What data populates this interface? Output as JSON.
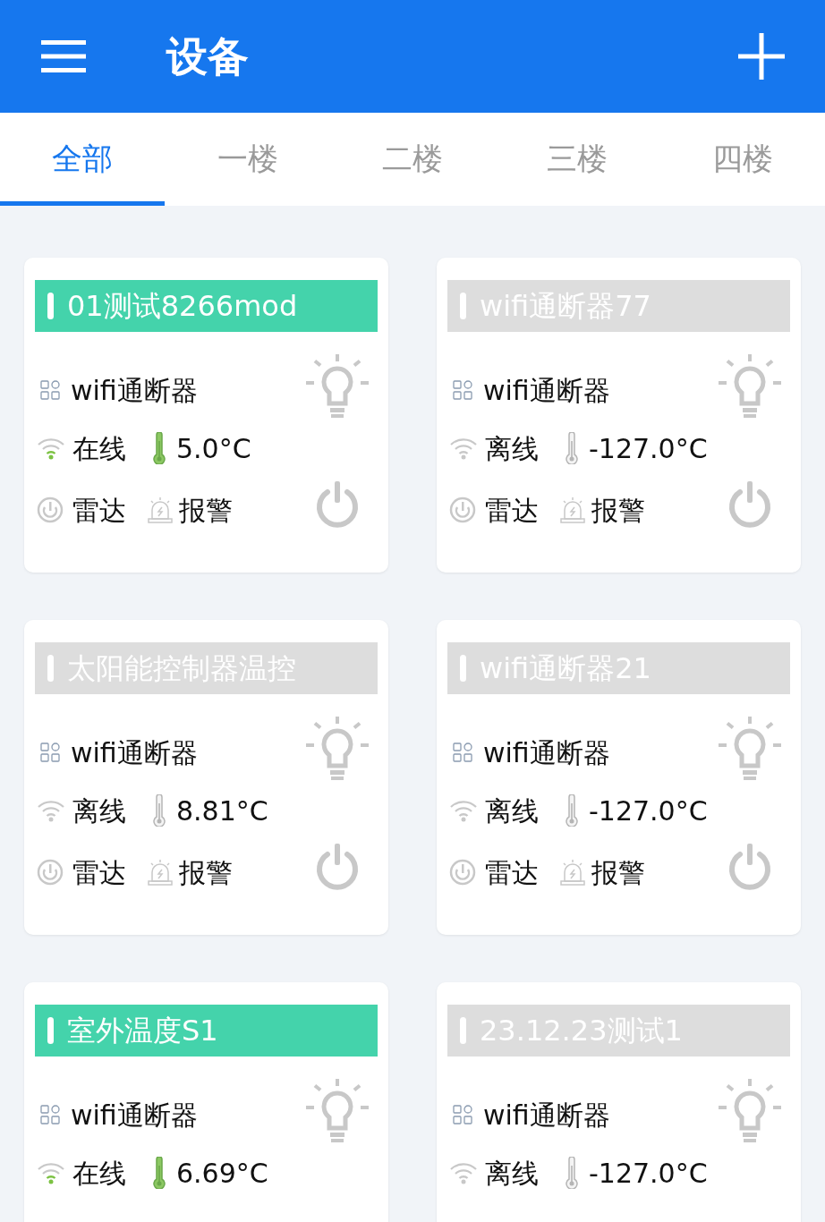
{
  "header": {
    "title": "设备"
  },
  "tabs": [
    {
      "label": "全部",
      "selected": true
    },
    {
      "label": "一楼",
      "selected": false
    },
    {
      "label": "二楼",
      "selected": false
    },
    {
      "label": "三楼",
      "selected": false
    },
    {
      "label": "四楼",
      "selected": false
    }
  ],
  "devices": [
    {
      "name": "01测试8266mod",
      "type": "wifi通断器",
      "online": true,
      "status": "在线",
      "temperature": "5.0°C",
      "radar": "雷达",
      "alarm": "报警"
    },
    {
      "name": "wifi通断器77",
      "type": "wifi通断器",
      "online": false,
      "status": "离线",
      "temperature": "-127.0°C",
      "radar": "雷达",
      "alarm": "报警"
    },
    {
      "name": "太阳能控制器温控",
      "type": "wifi通断器",
      "online": false,
      "status": "离线",
      "temperature": "8.81°C",
      "radar": "雷达",
      "alarm": "报警"
    },
    {
      "name": "wifi通断器21",
      "type": "wifi通断器",
      "online": false,
      "status": "离线",
      "temperature": "-127.0°C",
      "radar": "雷达",
      "alarm": "报警"
    },
    {
      "name": "室外温度S1",
      "type": "wifi通断器",
      "online": true,
      "status": "在线",
      "temperature": "6.69°C"
    },
    {
      "name": "23.12.23测试1",
      "type": "wifi通断器",
      "online": false,
      "status": "离线",
      "temperature": "-127.0°C"
    }
  ]
}
